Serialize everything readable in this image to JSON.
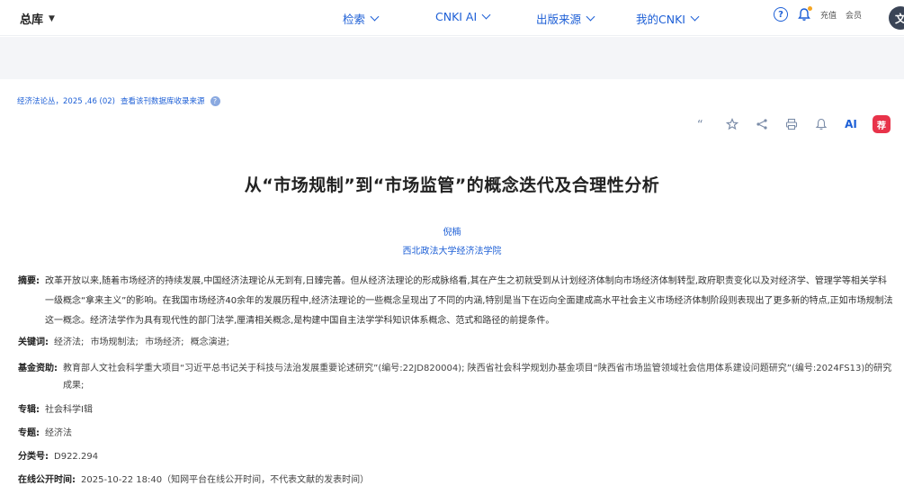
{
  "topbar": {
    "library_label": "总库",
    "nav": [
      {
        "label": "检索"
      },
      {
        "label": "CNKI AI"
      },
      {
        "label": "出版来源"
      },
      {
        "label": "我的CNKI"
      }
    ],
    "recharge_label": "充值",
    "member_label": "会员",
    "translate_glyph": "文"
  },
  "source": {
    "text": "经济法论丛，2025 ,46 (02)",
    "link": "查看该刊数据库收录来源"
  },
  "tools": {
    "ai_label": "AI",
    "rec_label": "荐"
  },
  "article": {
    "title": "从“市场规制”到“市场监管”的概念迭代及合理性分析",
    "author": "倪楠",
    "organization": "西北政法大学经济法学院",
    "abstract_label": "摘要:",
    "abstract": "改革开放以来,随着市场经济的持续发展,中国经济法理论从无到有,日臻完善。但从经济法理论的形成脉络看,其在产生之初就受到从计划经济体制向市场经济体制转型,政府职责变化以及对经济学、管理学等相关学科一级概念“拿来主义”的影响。在我国市场经济40余年的发展历程中,经济法理论的一些概念呈现出了不同的内涵,特别是当下在迈向全面建成高水平社会主义市场经济体制阶段则表现出了更多新的特点,正如市场规制法这一概念。经济法学作为具有现代性的部门法学,厘清相关概念,是构建中国自主法学学科知识体系概念、范式和路径的前提条件。",
    "keywords_label": "关键词:",
    "keywords": [
      "经济法;",
      "市场规制法;",
      "市场经济;",
      "概念演进;"
    ],
    "fund_label": "基金资助:",
    "fund": "教育部人文社会科学重大项目“习近平总书记关于科技与法治发展重要论述研究”(编号:22JD820004); 陕西省社会科学规划办基金项目“陕西省市场监管领域社会信用体系建设问题研究”(编号:2024FS13)的研究成果;",
    "series_label": "专辑:",
    "series": "社会科学Ⅰ辑",
    "topic_label": "专题:",
    "topic": "经济法",
    "class_label": "分类号:",
    "class_no": "D922.294",
    "online_label": "在线公开时间:",
    "online_time": "2025-10-22 18:40（知网平台在线公开时间，不代表文献的发表时间）"
  },
  "colors": {
    "accent": "#1d5fd6",
    "recommend": "#e8334a",
    "band": "#f4f5f8"
  }
}
